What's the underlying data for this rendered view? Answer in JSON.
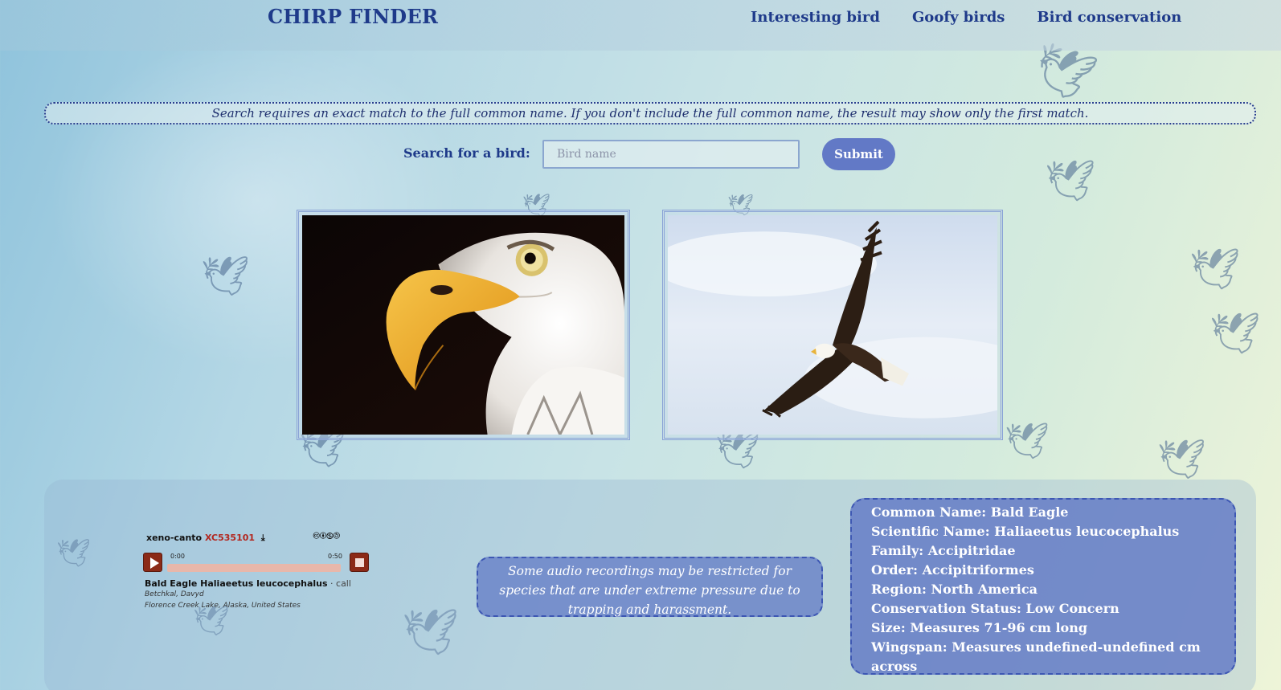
{
  "header": {
    "brand": "CHIRP FINDER",
    "nav": [
      "Interesting bird",
      "Goofy birds",
      "Bird conservation"
    ]
  },
  "notice": "Search requires an exact match to the full common name. If you don't include the full common name, the result may show only the first match.",
  "search": {
    "label": "Search for a bird:",
    "placeholder": "Bird name",
    "value": "",
    "submit_label": "Submit"
  },
  "player": {
    "source": "xeno-canto",
    "recording_id": "XC535101",
    "download_icon": "download-icon",
    "license_icons": "🅭🅯🄏🄎",
    "time_start": "0:00",
    "time_end": "0:50",
    "title": "Bald Eagle Haliaeetus leucocephalus",
    "type": " · call",
    "author": "Betchkal, Davyd",
    "location": "Florence Creek Lake, Alaska, United States"
  },
  "audio_note": "Some audio recordings may be restricted for species that are under extreme pressure due to trapping and harassment.",
  "info": {
    "common_name": "Common Name: Bald Eagle",
    "scientific_name": "Scientific Name: Haliaeetus leucocephalus",
    "family": "Family: Accipitridae",
    "order": "Order: Accipitriformes",
    "region": "Region: North America",
    "conservation": "Conservation Status: Low Concern",
    "size": "Size: Measures 71-96 cm long",
    "wingspan": "Wingspan: Measures undefined-undefined cm across"
  },
  "images": {
    "photo_1": "bald-eagle-head-closeup",
    "photo_2": "bald-eagle-in-flight"
  }
}
